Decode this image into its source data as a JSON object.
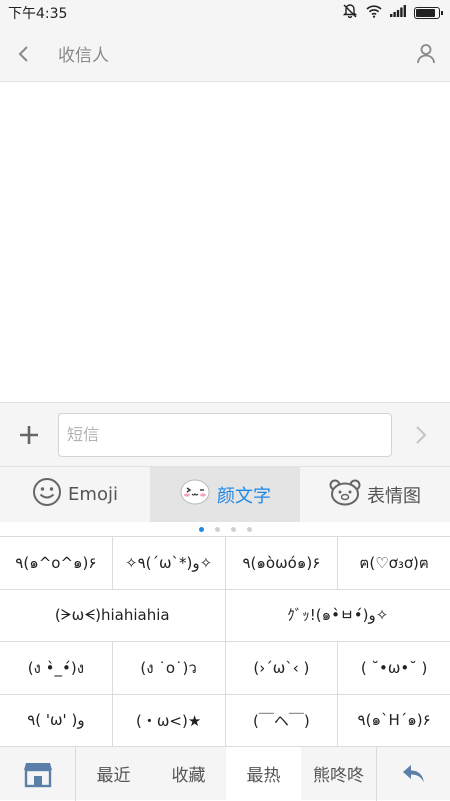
{
  "status_bar": {
    "time": "下午4:35",
    "battery_level": 0.9,
    "icons": [
      "muted-bell-icon",
      "wifi-icon",
      "signal-icon",
      "battery-icon"
    ]
  },
  "header": {
    "title": "收信人",
    "back_icon": "chevron-left-icon",
    "contact_icon": "person-icon"
  },
  "compose": {
    "placeholder": "短信",
    "value": "",
    "add_icon": "plus-icon",
    "send_icon": "chevron-right-icon"
  },
  "keyboard_tabs": [
    {
      "label": "Emoji",
      "icon": "smiley-icon",
      "active": false
    },
    {
      "label": "颜文字",
      "icon": "kaomoji-face-icon",
      "active": true
    },
    {
      "label": "表情图",
      "icon": "bear-icon",
      "active": false
    }
  ],
  "pager": {
    "count": 4,
    "active_index": 0
  },
  "kaomoji_rows": [
    [
      "٩(๑^o^๑)۶",
      "✧٩(ˊωˋ*)و✧",
      "٩(๑òωó๑)۶",
      "ฅ(♡ơ₃ơ)ฅ"
    ],
    [
      "(ᗒωᗕ)hiahiahia",
      "ｸﾞｯ!(๑•̀ㅂ•́)و✧"
    ],
    [
      "(ง •̀_•́)ง",
      "(ง ˙o˙)ว",
      "(›´ω`‹ )",
      "( ˘•ω•˘ )"
    ],
    [
      "٩( 'ω' )و",
      "(・ω<)★",
      "(￣ヘ￣)",
      "٩(๑`Н´๑)۶"
    ]
  ],
  "bottom_bar": {
    "store_icon": "store-icon",
    "categories": [
      {
        "label": "最近",
        "active": false
      },
      {
        "label": "收藏",
        "active": false
      },
      {
        "label": "最热",
        "active": true
      },
      {
        "label": "熊咚咚",
        "active": false
      }
    ],
    "return_icon": "return-arrow-icon"
  },
  "colors": {
    "accent": "#1e88e5",
    "cursor": "#e87a2a",
    "bar_bg": "#f5f5f5"
  }
}
